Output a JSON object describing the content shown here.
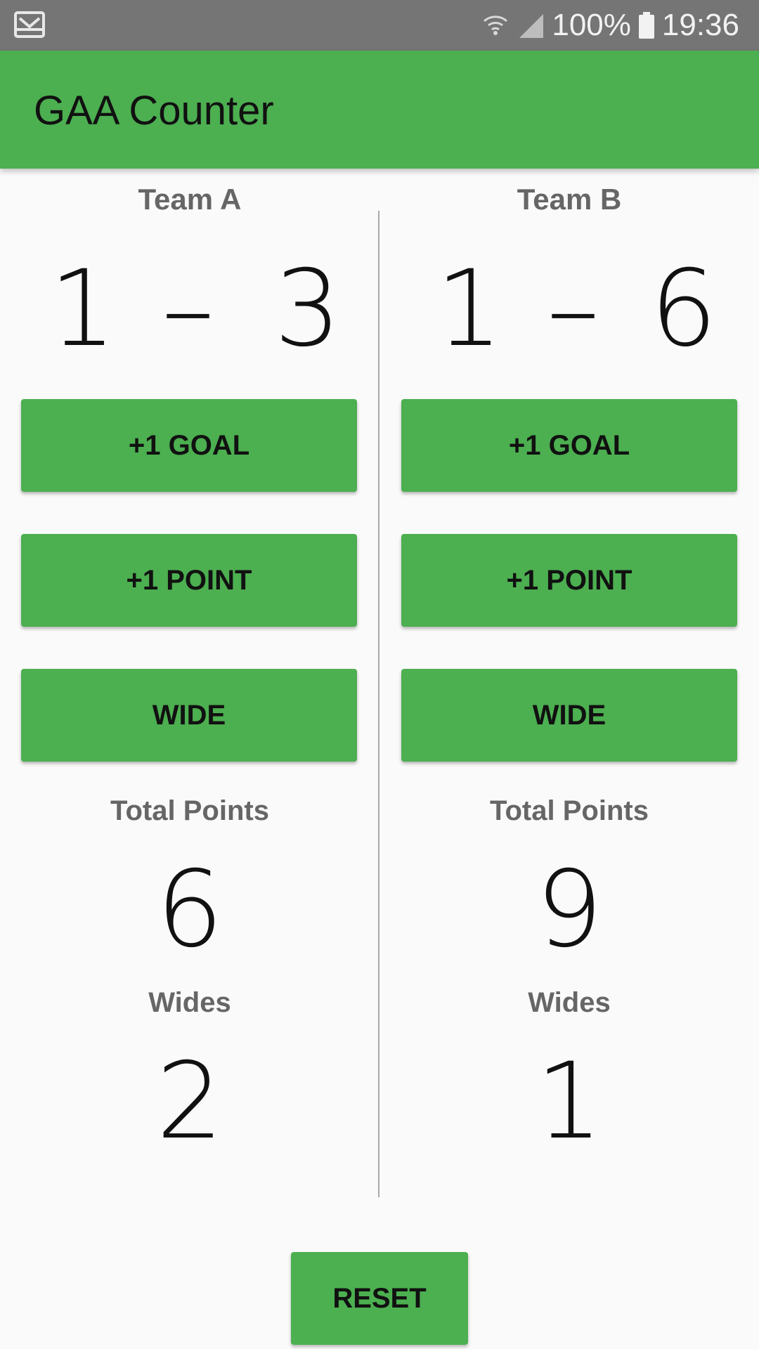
{
  "status_bar": {
    "battery_text": "100%",
    "time": "19:36",
    "icons": [
      "mail-icon",
      "wifi-icon",
      "signal-icon",
      "battery-icon"
    ]
  },
  "app_bar": {
    "title": "GAA Counter",
    "color": "#4caf50"
  },
  "teams": [
    {
      "name": "Team A",
      "goals": "1",
      "separator": "–",
      "points": "3",
      "buttons": {
        "goal": "+1 GOAL",
        "point": "+1 POINT",
        "wide": "WIDE"
      },
      "total_points_label": "Total Points",
      "total_points": "6",
      "wides_label": "Wides",
      "wides": "2"
    },
    {
      "name": "Team B",
      "goals": "1",
      "separator": "–",
      "points": "6",
      "buttons": {
        "goal": "+1 GOAL",
        "point": "+1 POINT",
        "wide": "WIDE"
      },
      "total_points_label": "Total Points",
      "total_points": "9",
      "wides_label": "Wides",
      "wides": "1"
    }
  ],
  "reset_label": "RESET",
  "colors": {
    "accent": "#4caf50",
    "status_bar": "#757575",
    "label_gray": "#666666"
  }
}
